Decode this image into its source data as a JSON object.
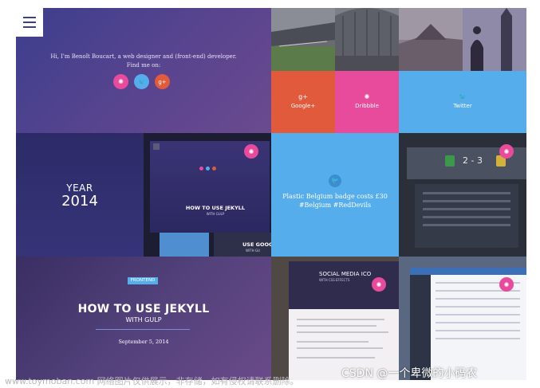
{
  "intro": {
    "greeting": "Hi, I'm Benoît Boucart, a web designer and (front-end) developer.",
    "find_me": "Find me on:",
    "social": [
      {
        "icon": "dribbble-icon",
        "glyph": "✺",
        "color": "#e84b9b"
      },
      {
        "icon": "twitter-icon",
        "glyph": "🐦",
        "color": "#56adeb"
      },
      {
        "icon": "googleplus-icon",
        "glyph": "g+",
        "color": "#e05a3b"
      }
    ]
  },
  "social_tiles": {
    "googleplus": {
      "glyph": "g+",
      "label": "Google+",
      "color": "#e05a3b"
    },
    "dribbble": {
      "glyph": "✺",
      "label": "Dribbble",
      "color": "#e84b9b"
    },
    "twitter": {
      "glyph": "🐦",
      "label": "Twitter",
      "color": "#56adeb"
    }
  },
  "year_tile": {
    "label": "YEAR",
    "year": "2014"
  },
  "jekyll_screenshot": {
    "title": "HOW TO USE JEKYLL",
    "subtitle": "WITH GULP",
    "side_text": "USE GOOG",
    "side_sub": "WITH GU"
  },
  "tweet_tile": {
    "glyph": "🐦",
    "text_line1": "Plastic Belgium badge costs £30",
    "text_line2": "#Belgium #RedDevils"
  },
  "football_tile": {
    "score": "2 - 3"
  },
  "hero_post": {
    "category": "FRONTEND",
    "title": "HOW TO USE JEKYLL",
    "subtitle": "WITH GULP",
    "date": "September 5, 2014"
  },
  "social_post": {
    "title": "SOCIAL MEDIA ICO",
    "subtitle": "WITH CSS EFFECTS"
  },
  "pink_glyph": "✺",
  "watermarks": {
    "left": "www.toymoban.com 网络图片仅供展示，非存储，如有侵权请联系删除。",
    "right": "CSDN @一个卑微的小码农"
  }
}
